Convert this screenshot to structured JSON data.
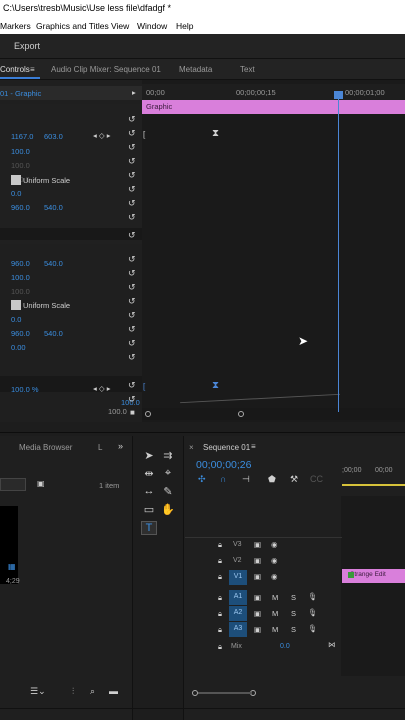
{
  "titlebar": {
    "path": "C:\\Users\\tresb\\Music\\Use less file\\dfadgf *"
  },
  "menu": {
    "items": [
      "Markers",
      "Graphics and Titles",
      "View",
      "Window",
      "Help"
    ]
  },
  "workspace": {
    "export_label": "Export"
  },
  "tabs": [
    {
      "label": "Controls",
      "active": true
    },
    {
      "label": "Audio Clip Mixer: Sequence 01"
    },
    {
      "label": "Metadata"
    },
    {
      "label": "Text"
    }
  ],
  "effect_controls": {
    "source_label": "01 - Graphic",
    "ruler": [
      "00;00",
      "00;00;00;15",
      "00;00;01;00"
    ],
    "clip_label": "Graphic",
    "position_x": "1167.0",
    "position_y": "603.0",
    "scale": "100.0",
    "scale_dim1": "100.0",
    "scale_dim2": "100.0",
    "uniform_scale": "Uniform Scale",
    "rotation": "0.0",
    "anchor_x": "960.0",
    "anchor_y": "540.0",
    "position2_x": "960.0",
    "position2_y": "540.0",
    "scale2": "100.0",
    "scale2_dim": "100.0",
    "uniform_scale2": "Uniform Scale",
    "rotation2": "0.0",
    "anchor2_x": "960.0",
    "anchor2_y": "540.0",
    "opacity": "0.00",
    "bottom_value": "100.0 %",
    "graph_top": "100.0",
    "graph_bottom": "100.0"
  },
  "project": {
    "tab_media_browser": "Media Browser",
    "tab_more": "L",
    "item_count": "1 item",
    "thumb_duration": "4;29"
  },
  "sequence": {
    "tab_label": "Sequence 01",
    "timecode": "00;00;00;26",
    "ruler": [
      ";00;00",
      "00;00"
    ],
    "tracks": [
      {
        "label": "V3"
      },
      {
        "label": "V2"
      },
      {
        "label": "V1"
      },
      {
        "label": "A1"
      },
      {
        "label": "A2"
      },
      {
        "label": "A3"
      }
    ],
    "mix_label": "Mix",
    "mix_value": "0.0",
    "clip_label": "Strange Edit"
  },
  "colors": {
    "accent": "#3b8ee0",
    "clip": "#d97fdb",
    "playhead": "#4b86d6"
  }
}
